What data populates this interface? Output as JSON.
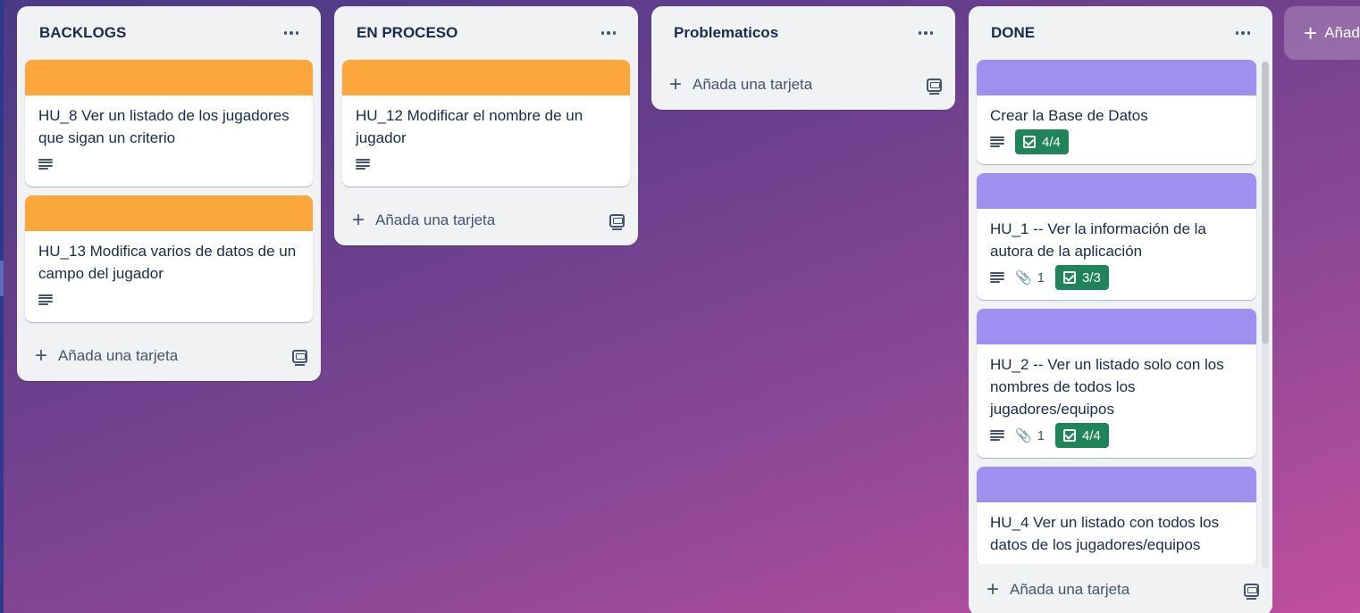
{
  "board": {
    "lists": [
      {
        "title": "BACKLOGS",
        "add_label": "Añada una tarjeta",
        "cards": [
          {
            "title": "HU_8 Ver un listado de los jugadores que sigan un criterio",
            "cover": "#fca73c"
          },
          {
            "title": "HU_13 Modifica varios de datos de un campo del jugador",
            "cover": "#fca73c"
          }
        ]
      },
      {
        "title": "EN PROCESO",
        "add_label": "Añada una tarjeta",
        "cards": [
          {
            "title": "HU_12 Modificar el nombre de un jugador",
            "cover": "#fca73c"
          }
        ]
      },
      {
        "title": "Problematicos",
        "add_label": "Añada una tarjeta",
        "cards": []
      },
      {
        "title": "DONE",
        "add_label": "Añada una tarjeta",
        "cards": [
          {
            "title": "Crear la Base de Datos",
            "cover": "#9f8fef",
            "checklist": "4/4"
          },
          {
            "title": "HU_1 -- Ver la información de la autora de la aplicación",
            "cover": "#9f8fef",
            "attachments": "1",
            "checklist": "3/3"
          },
          {
            "title": "HU_2 -- Ver un listado solo con los nombres de todos los jugadores/equipos",
            "cover": "#9f8fef",
            "attachments": "1",
            "checklist": "4/4"
          },
          {
            "title": "HU_4 Ver un listado con todos los datos de los jugadores/equipos",
            "cover": "#9f8fef"
          }
        ]
      }
    ],
    "add_list_label": "Añad",
    "colors": {
      "cover_orange": "#fca73c",
      "cover_purple": "#9f8fef",
      "checklist_complete": "#1f845a",
      "list_bg": "#f1f2f4"
    }
  }
}
